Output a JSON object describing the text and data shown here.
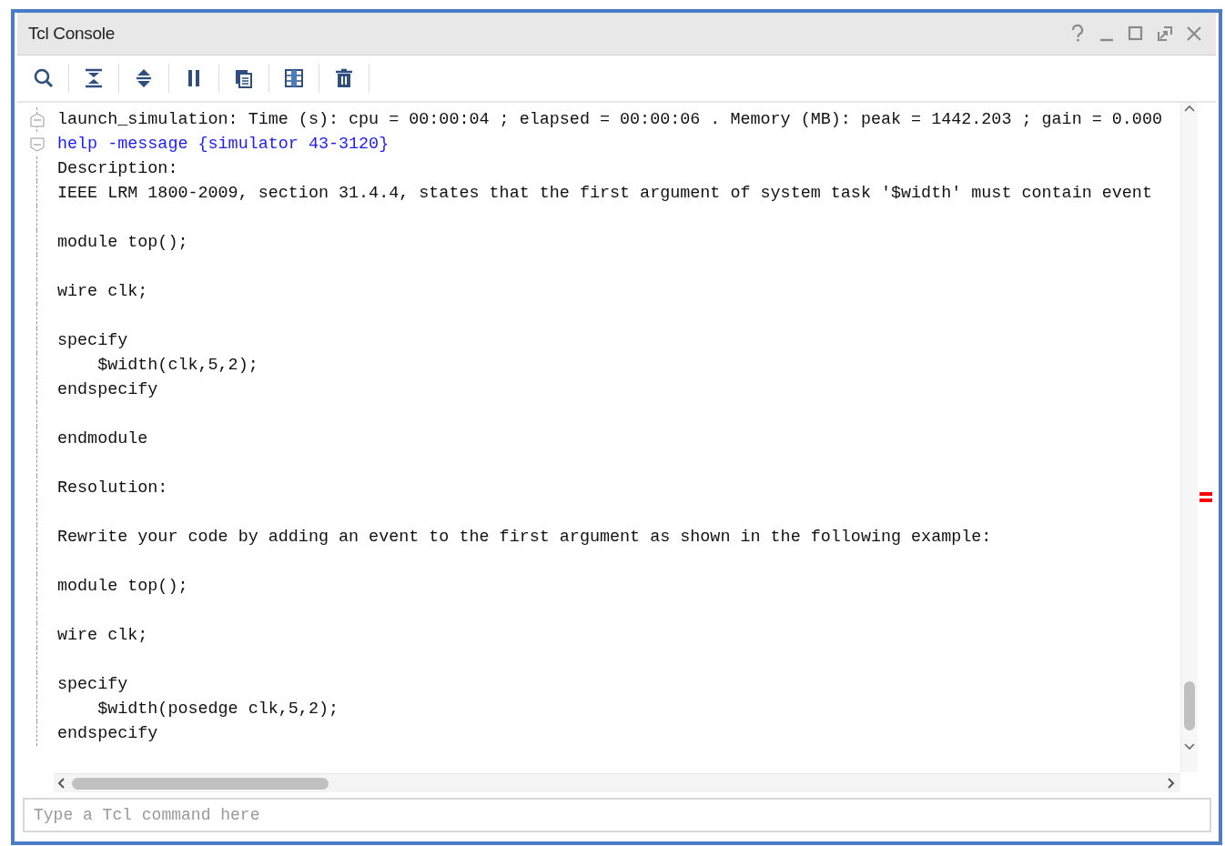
{
  "window": {
    "title": "Tcl Console"
  },
  "console": {
    "lines": [
      {
        "kind": "output",
        "expanded": false,
        "text": "launch_simulation: Time (s): cpu = 00:00:04 ; elapsed = 00:00:06 . Memory (MB): peak = 1442.203 ; gain = 0.000"
      },
      {
        "kind": "command",
        "expanded": true,
        "text": "help -message {simulator 43-3120}"
      },
      {
        "kind": "output",
        "text": "Description:"
      },
      {
        "kind": "output",
        "text": "IEEE LRM 1800-2009, section 31.4.4, states that the first argument of system task '$width' must contain event"
      },
      {
        "kind": "blank"
      },
      {
        "kind": "output",
        "text": "module top();"
      },
      {
        "kind": "blank"
      },
      {
        "kind": "output",
        "text": "wire clk;"
      },
      {
        "kind": "blank"
      },
      {
        "kind": "output",
        "text": "specify"
      },
      {
        "kind": "output",
        "text": "    $width(clk,5,2);"
      },
      {
        "kind": "output",
        "text": "endspecify"
      },
      {
        "kind": "blank"
      },
      {
        "kind": "output",
        "text": "endmodule"
      },
      {
        "kind": "blank"
      },
      {
        "kind": "output",
        "text": "Resolution:"
      },
      {
        "kind": "blank"
      },
      {
        "kind": "output",
        "text": "Rewrite your code by adding an event to the first argument as shown in the following example:"
      },
      {
        "kind": "blank"
      },
      {
        "kind": "output",
        "text": "module top();"
      },
      {
        "kind": "blank"
      },
      {
        "kind": "output",
        "text": "wire clk;"
      },
      {
        "kind": "blank"
      },
      {
        "kind": "output",
        "text": "specify"
      },
      {
        "kind": "output",
        "text": "    $width(posedge clk,5,2);"
      },
      {
        "kind": "output",
        "text": "endspecify"
      }
    ]
  },
  "command_input": {
    "placeholder": "Type a Tcl command here"
  }
}
